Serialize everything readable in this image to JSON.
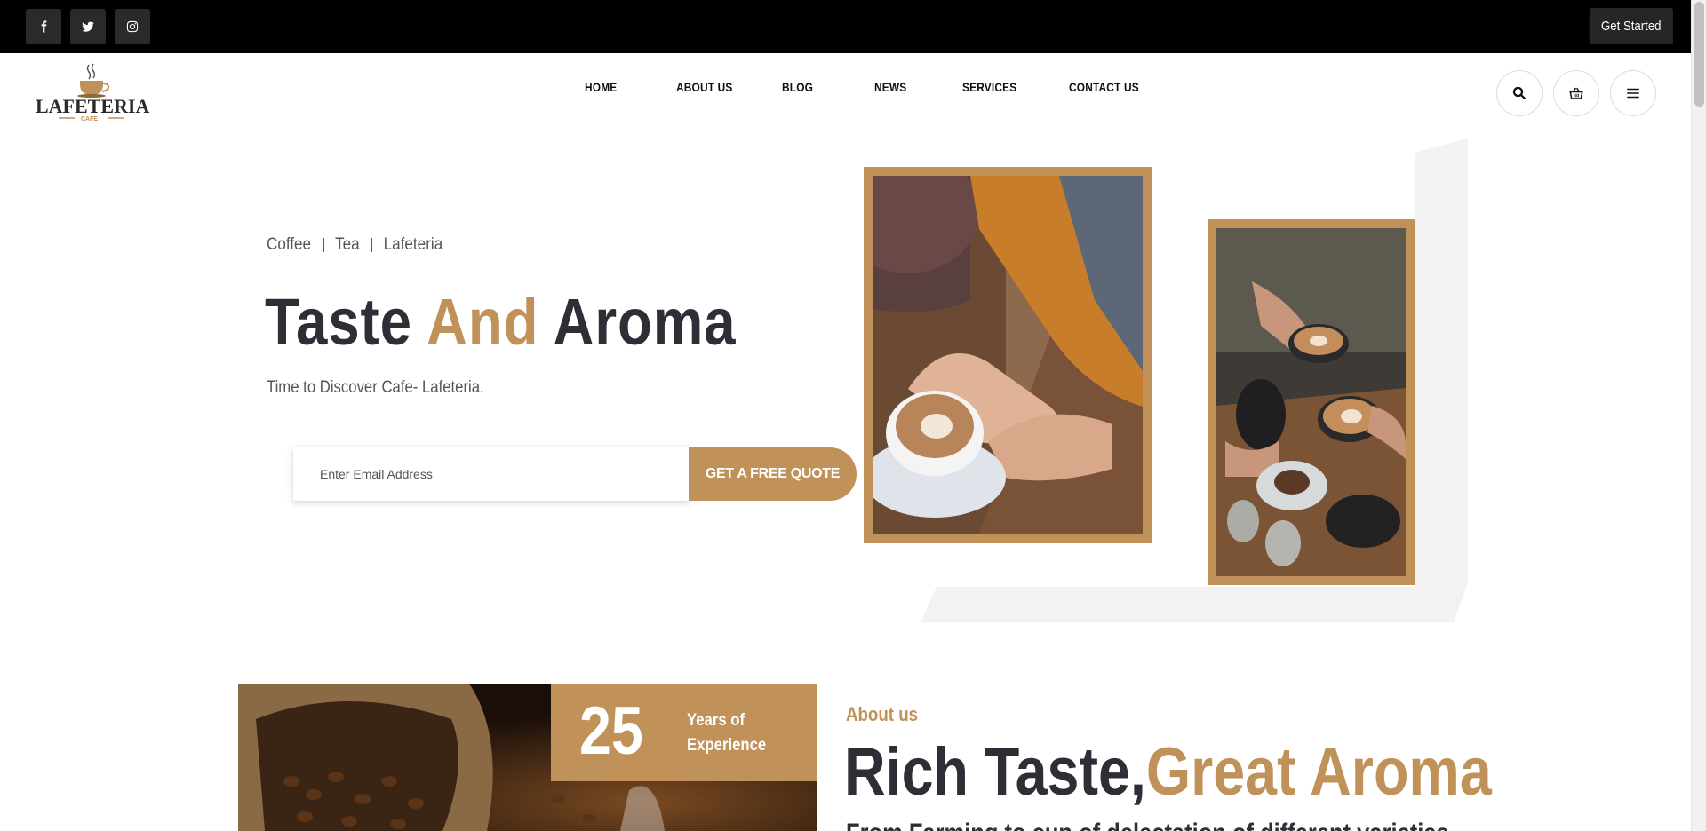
{
  "topbar": {
    "social": [
      {
        "name": "facebook-icon"
      },
      {
        "name": "twitter-icon"
      },
      {
        "name": "instagram-icon"
      }
    ],
    "cta_label": "Get Started"
  },
  "header": {
    "logo": {
      "brand": "LAFETERIA",
      "sub": "CAFE"
    },
    "nav": [
      "HOME",
      "ABOUT US",
      "BLOG",
      "NEWS",
      "SERVICES",
      "CONTACT US"
    ],
    "icons": [
      "search-icon",
      "basket-icon",
      "menu-icon"
    ]
  },
  "hero": {
    "tags": [
      "Coffee",
      "Tea",
      "Lafeteria"
    ],
    "title_part1": "Taste",
    "title_accent": "And",
    "title_part2": "Aroma",
    "subtitle": "Time to Discover Cafe- Lafeteria.",
    "email_placeholder": "Enter Email Address",
    "quote_button": "GET A FREE QUOTE"
  },
  "about": {
    "years_number": "25",
    "years_line1": "Years of",
    "years_line2": "Experience",
    "kicker": "About us",
    "title_part1": "Rich Taste,",
    "title_accent": "Great Aroma",
    "body_cut": "From Farming to cup of delectation of different varieties"
  },
  "colors": {
    "accent": "#c09158",
    "dark": "#2e2f36",
    "topbar": "#000000"
  }
}
